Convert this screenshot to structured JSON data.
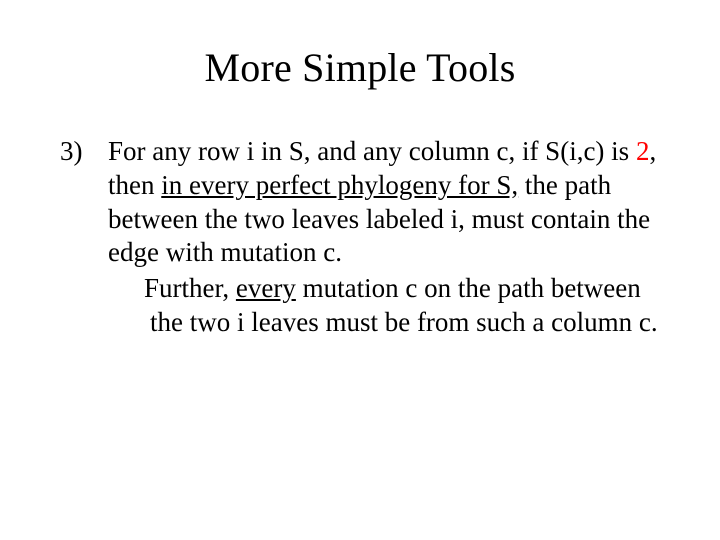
{
  "title": "More Simple Tools",
  "list": {
    "marker": "3)",
    "p1_a": "For any row i in S, and any column c, if S(i,c) is ",
    "p1_two": "2",
    "p1_b": ", then ",
    "p1_u": "in every perfect phylogeny for S,",
    "p1_c": " the path between the two leaves labeled i, must contain the edge with mutation c.",
    "p2_a": "Further, ",
    "p2_u": "every",
    "p2_b": " mutation  c on the path between the two i leaves must be from such a column c."
  },
  "colors": {
    "highlight": "#ff0000"
  }
}
